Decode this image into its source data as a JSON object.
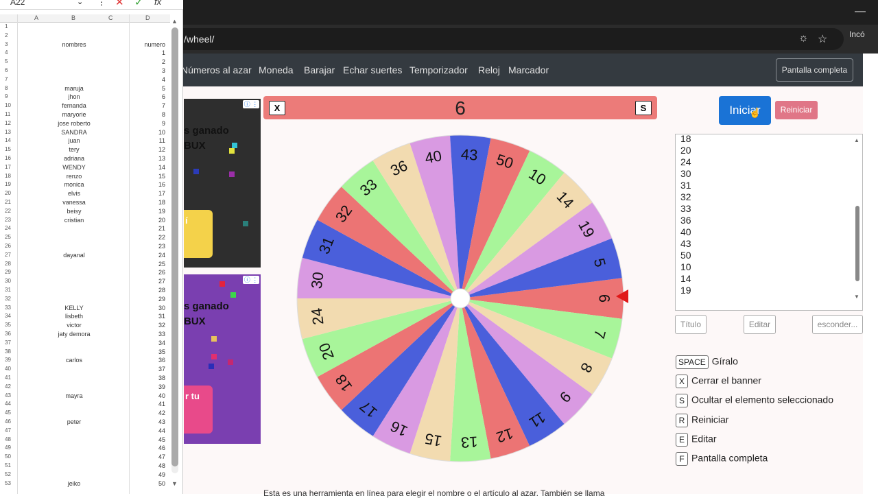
{
  "browser": {
    "address": "/wheel/",
    "incognito_label": "Incó"
  },
  "nav": {
    "links": [
      "Números al azar",
      "Moneda",
      "Barajar",
      "Echar suertes",
      "Temporizador",
      "Reloj",
      "Marcador"
    ],
    "fullscreen": "Pantalla completa"
  },
  "ads": {
    "line1": "s ganado",
    "line2": "BUX",
    "btn1": "í",
    "btn2": "r tu"
  },
  "banner": {
    "close_key": "X",
    "value": "6",
    "hide_key": "S"
  },
  "controls": {
    "start": "Iniciar",
    "reset": "Reiniciar",
    "title_btn": "Título",
    "edit_btn": "Editar",
    "hide_btn": "esconder..."
  },
  "list": {
    "items": [
      "18",
      "20",
      "24",
      "30",
      "31",
      "32",
      "33",
      "36",
      "40",
      "43",
      "50",
      "10",
      "14",
      "19"
    ]
  },
  "shortcuts": [
    {
      "key": "SPACE",
      "label": "Gíralo"
    },
    {
      "key": "X",
      "label": "Cerrar el banner"
    },
    {
      "key": "S",
      "label": "Ocultar el elemento seleccionado"
    },
    {
      "key": "R",
      "label": "Reiniciar"
    },
    {
      "key": "E",
      "label": "Editar"
    },
    {
      "key": "F",
      "label": "Pantalla completa"
    }
  ],
  "bottom_text": "Esta es una herramienta en línea para elegir el nombre o el artículo al azar. También se llama",
  "wheel": {
    "segments": [
      {
        "label": "6",
        "color": "#ec7474"
      },
      {
        "label": "7",
        "color": "#a8f59a"
      },
      {
        "label": "8",
        "color": "#f2dbb0"
      },
      {
        "label": "9",
        "color": "#d99ae2"
      },
      {
        "label": "11",
        "color": "#4a5fdb"
      },
      {
        "label": "12",
        "color": "#ec7474"
      },
      {
        "label": "13",
        "color": "#a8f59a"
      },
      {
        "label": "15",
        "color": "#f2dbb0"
      },
      {
        "label": "16",
        "color": "#d99ae2"
      },
      {
        "label": "17",
        "color": "#4a5fdb"
      },
      {
        "label": "18",
        "color": "#ec7474"
      },
      {
        "label": "20",
        "color": "#a8f59a"
      },
      {
        "label": "24",
        "color": "#f2dbb0"
      },
      {
        "label": "30",
        "color": "#d99ae2"
      },
      {
        "label": "31",
        "color": "#4a5fdb"
      },
      {
        "label": "32",
        "color": "#ec7474"
      },
      {
        "label": "33",
        "color": "#a8f59a"
      },
      {
        "label": "36",
        "color": "#f2dbb0"
      },
      {
        "label": "40",
        "color": "#d99ae2"
      },
      {
        "label": "43",
        "color": "#4a5fdb"
      },
      {
        "label": "50",
        "color": "#ec7474"
      },
      {
        "label": "10",
        "color": "#a8f59a"
      },
      {
        "label": "14",
        "color": "#f2dbb0"
      },
      {
        "label": "19",
        "color": "#d99ae2"
      },
      {
        "label": "5",
        "color": "#4a5fdb"
      }
    ]
  },
  "sheet": {
    "namebox": "A22",
    "columns": [
      "A",
      "B",
      "C",
      "D"
    ],
    "rows": [
      {
        "n": "1",
        "name": "",
        "num": ""
      },
      {
        "n": "2",
        "name": "",
        "num": ""
      },
      {
        "n": "3",
        "name": "nombres",
        "num": "numero"
      },
      {
        "n": "4",
        "name": "",
        "num": "1"
      },
      {
        "n": "5",
        "name": "",
        "num": "2"
      },
      {
        "n": "6",
        "name": "",
        "num": "3"
      },
      {
        "n": "7",
        "name": "",
        "num": "4"
      },
      {
        "n": "8",
        "name": "maruja",
        "num": "5"
      },
      {
        "n": "9",
        "name": "jhon",
        "num": "6"
      },
      {
        "n": "10",
        "name": "fernanda",
        "num": "7"
      },
      {
        "n": "11",
        "name": "maryorie",
        "num": "8"
      },
      {
        "n": "12",
        "name": "jose roberto",
        "num": "9"
      },
      {
        "n": "13",
        "name": "SANDRA",
        "num": "10"
      },
      {
        "n": "14",
        "name": "juan",
        "num": "11"
      },
      {
        "n": "15",
        "name": "tery",
        "num": "12"
      },
      {
        "n": "16",
        "name": "adriana",
        "num": "13"
      },
      {
        "n": "17",
        "name": "WENDY",
        "num": "14"
      },
      {
        "n": "18",
        "name": "renzo",
        "num": "15"
      },
      {
        "n": "19",
        "name": "monica",
        "num": "16"
      },
      {
        "n": "20",
        "name": "elvis",
        "num": "17"
      },
      {
        "n": "21",
        "name": "vanessa",
        "num": "18"
      },
      {
        "n": "22",
        "name": "beisy",
        "num": "19"
      },
      {
        "n": "23",
        "name": "cristian",
        "num": "20"
      },
      {
        "n": "24",
        "name": "",
        "num": "21"
      },
      {
        "n": "25",
        "name": "",
        "num": "22"
      },
      {
        "n": "26",
        "name": "",
        "num": "23"
      },
      {
        "n": "27",
        "name": "dayanal",
        "num": "24"
      },
      {
        "n": "28",
        "name": "",
        "num": "25"
      },
      {
        "n": "29",
        "name": "",
        "num": "26"
      },
      {
        "n": "30",
        "name": "",
        "num": "27"
      },
      {
        "n": "31",
        "name": "",
        "num": "28"
      },
      {
        "n": "32",
        "name": "",
        "num": "29"
      },
      {
        "n": "33",
        "name": "KELLY",
        "num": "30"
      },
      {
        "n": "34",
        "name": "lisbeth",
        "num": "31"
      },
      {
        "n": "35",
        "name": "victor",
        "num": "32"
      },
      {
        "n": "36",
        "name": "jaty demora",
        "num": "33"
      },
      {
        "n": "37",
        "name": "",
        "num": "34"
      },
      {
        "n": "38",
        "name": "",
        "num": "35"
      },
      {
        "n": "39",
        "name": "carlos",
        "num": "36"
      },
      {
        "n": "40",
        "name": "",
        "num": "37"
      },
      {
        "n": "41",
        "name": "",
        "num": "38"
      },
      {
        "n": "42",
        "name": "",
        "num": "39"
      },
      {
        "n": "43",
        "name": "mayra",
        "num": "40"
      },
      {
        "n": "44",
        "name": "",
        "num": "41"
      },
      {
        "n": "45",
        "name": "",
        "num": "42"
      },
      {
        "n": "46",
        "name": "peter",
        "num": "43"
      },
      {
        "n": "47",
        "name": "",
        "num": "44"
      },
      {
        "n": "48",
        "name": "",
        "num": "45"
      },
      {
        "n": "49",
        "name": "",
        "num": "46"
      },
      {
        "n": "50",
        "name": "",
        "num": "47"
      },
      {
        "n": "51",
        "name": "",
        "num": "48"
      },
      {
        "n": "52",
        "name": "",
        "num": "49"
      },
      {
        "n": "53",
        "name": "jeiko",
        "num": "50"
      }
    ]
  }
}
